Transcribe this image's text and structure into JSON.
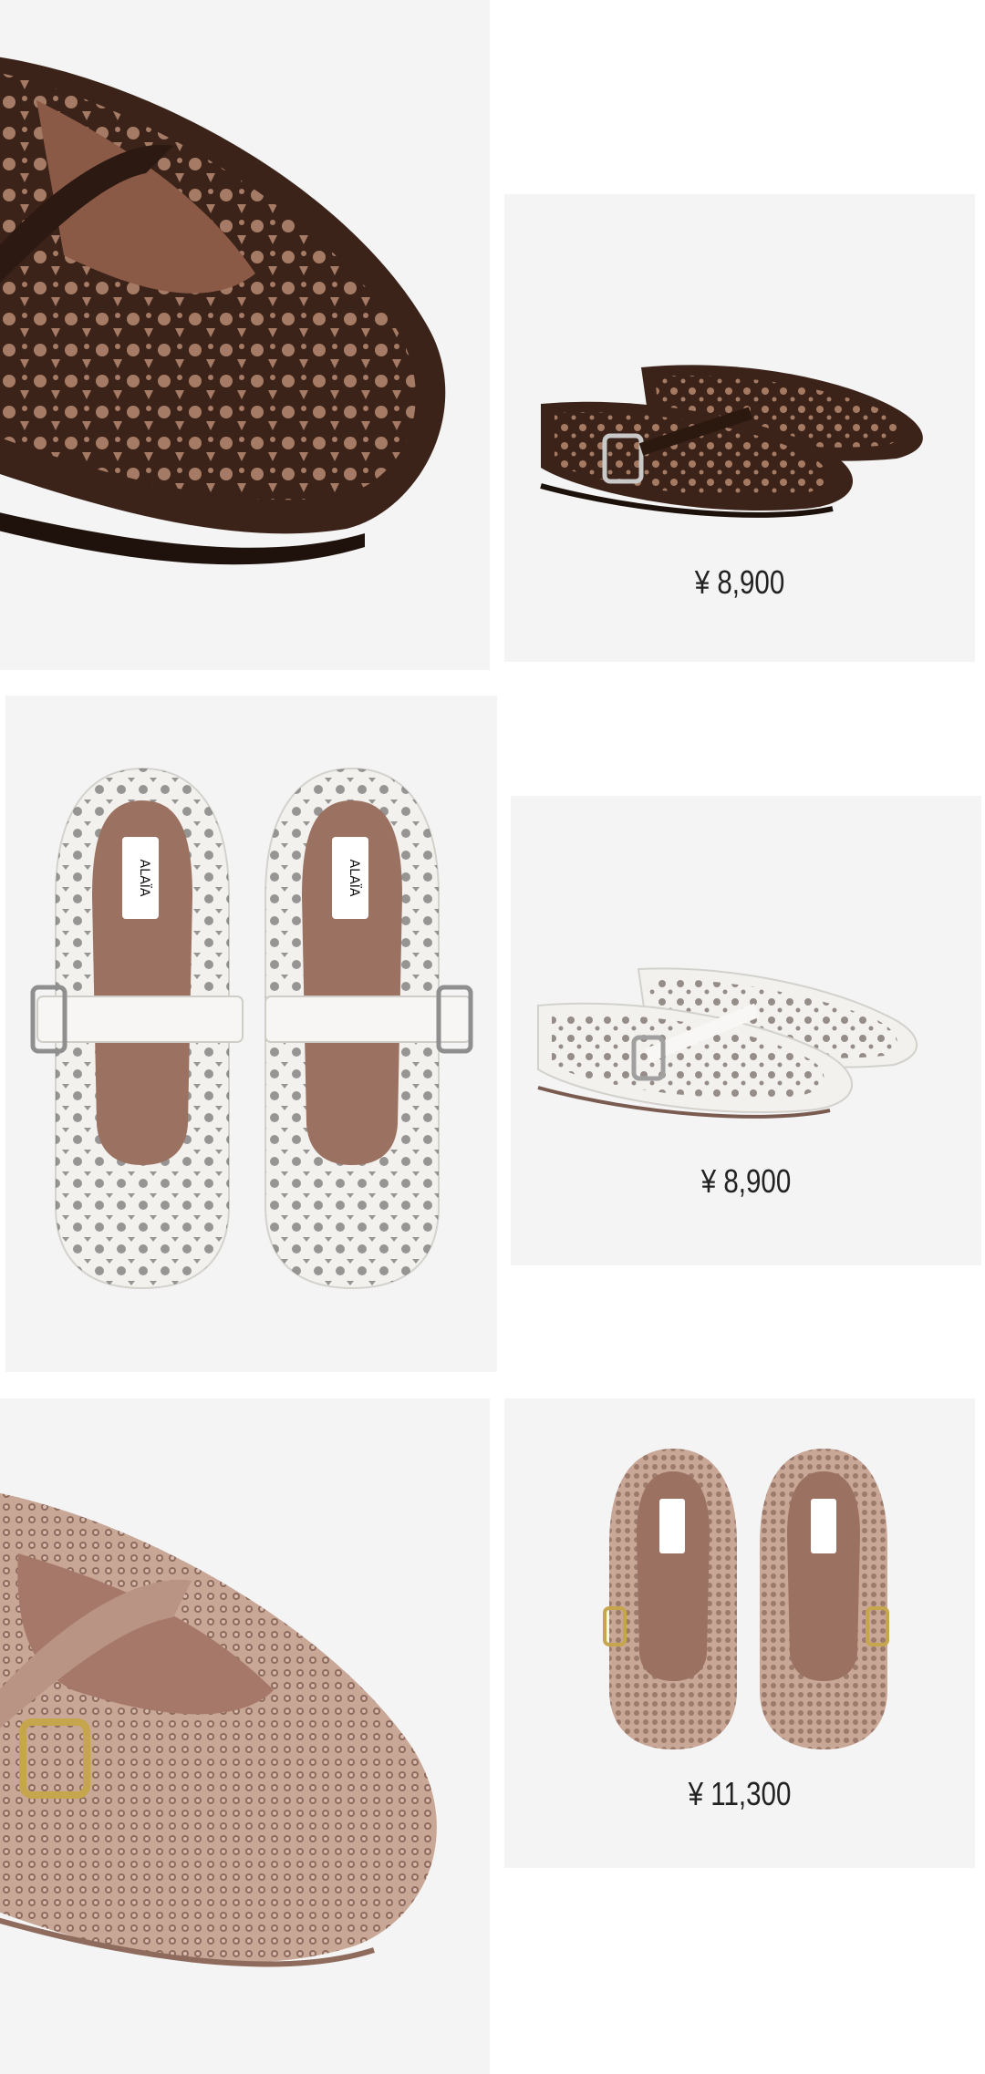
{
  "colors": {
    "page_background": "#ffffff",
    "card_background": "#f4f4f4",
    "brown_suede": "#3b2319",
    "white_leather": "#f2f1ee",
    "woven_pink": "#c8a796",
    "lining": "#9b7262"
  },
  "rows": [
    {
      "detail_photo": "brown-suede-flat-closeup",
      "product": {
        "image": "brown-suede-mary-jane-pair-side",
        "price": "¥ 8,900"
      }
    },
    {
      "detail_photo": "white-leather-mary-jane-top-view",
      "product": {
        "image": "white-leather-mary-jane-pair-side",
        "price": "¥ 8,900"
      }
    },
    {
      "detail_photo": "woven-mary-jane-closeup",
      "product": {
        "image": "woven-mary-jane-pair-top",
        "price": "¥ 11,300"
      }
    }
  ],
  "brand_label": "ALAÏA"
}
